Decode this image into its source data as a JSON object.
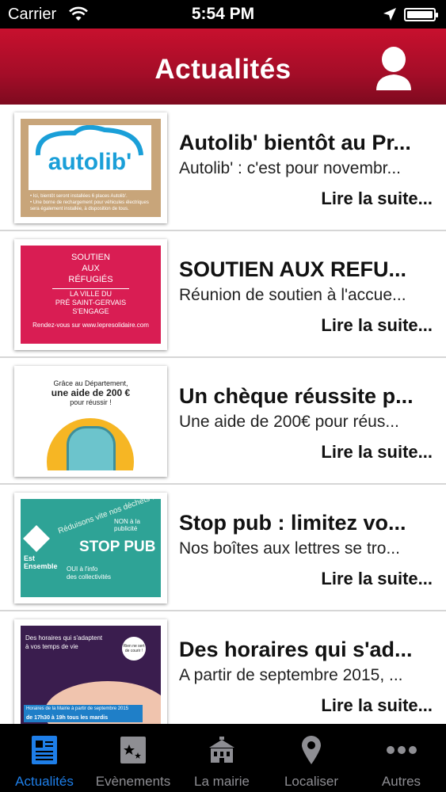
{
  "status_bar": {
    "carrier": "Carrier",
    "time": "5:54 PM"
  },
  "header": {
    "title": "Actualités"
  },
  "articles": [
    {
      "title": "Autolib' bientôt au Pr...",
      "summary": "Autolib' : c'est pour novembr...",
      "more": "Lire la suite...",
      "thumb": {
        "logo": "autolib'",
        "fine_1": "• Ici, bientôt seront installées 6 places Autolib'.",
        "fine_2": "• Une borne de rechargement pour véhicules électriques sera également installée, à disposition de tous."
      }
    },
    {
      "title": "SOUTIEN AUX REFU...",
      "summary": "Réunion de soutien à l'accue...",
      "more": "Lire la suite...",
      "thumb": {
        "line_1": "SOUTIEN",
        "line_2": "AUX",
        "line_3": "RÉFUGIÉS",
        "line_4": "LA VILLE DU",
        "line_5": "PRÉ SAINT-GERVAIS",
        "line_6": "S'ENGAGE",
        "line_7": "Rendez-vous sur www.lepresolidaire.com"
      }
    },
    {
      "title": "Un chèque réussite p...",
      "summary": "Une aide de 200€ pour réus...",
      "more": "Lire la suite...",
      "thumb": {
        "line_1": "Grâce au Département,",
        "line_2": "une aide de 200 €",
        "line_3": "pour réussir !"
      }
    },
    {
      "title": "Stop pub : limitez vo...",
      "summary": "Nos boîtes aux lettres se tro...",
      "more": "Lire la suite...",
      "thumb": {
        "brand_1": "Est",
        "brand_2": "Ensemble",
        "curve": "Réduisons vite nos déchets !",
        "non": "NON à la publicité",
        "stop": "STOP PUB",
        "oui_1": "OUI à l'info",
        "oui_2": "des collectivités"
      }
    },
    {
      "title": "Des horaires qui s'ad...",
      "summary": "A partir de septembre 2015, ...",
      "more": "Lire la suite...",
      "thumb": {
        "line_1": "Des horaires qui s'adaptent",
        "line_2": "à vos temps de vie",
        "bubble": "Rien ne sert de courir !",
        "bar_1": "Horaires de la Mairie à partir de septembre 2015",
        "bar_2": "de 17h30 à 19h tous les mardis"
      }
    }
  ],
  "tabs": [
    {
      "label": "Actualités",
      "icon": "newspaper-icon",
      "active": true
    },
    {
      "label": "Evènements",
      "icon": "calendar-star-icon",
      "active": false
    },
    {
      "label": "La mairie",
      "icon": "town-hall-icon",
      "active": false
    },
    {
      "label": "Localiser",
      "icon": "map-pin-icon",
      "active": false
    },
    {
      "label": "Autres",
      "icon": "more-dots-icon",
      "active": false
    }
  ],
  "colors": {
    "header_red": "#b00d2a",
    "tab_active": "#1e7ee8",
    "tab_inactive": "#8e8e93"
  }
}
